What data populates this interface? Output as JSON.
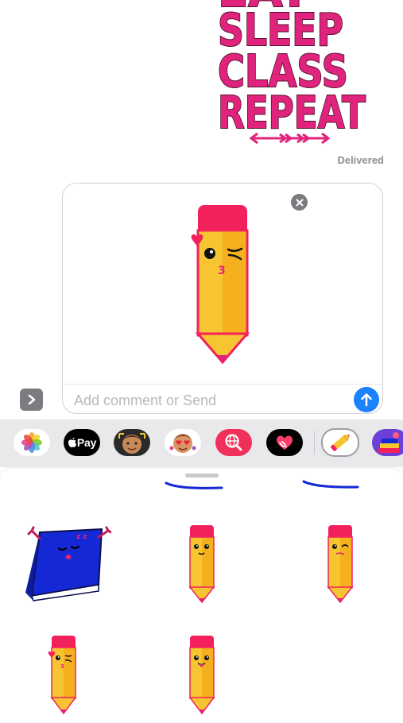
{
  "conversation": {
    "sent_sticker": {
      "lines": [
        "EAT",
        "SLEEP",
        "CLASS",
        "REPEAT"
      ],
      "color": "#e0247d"
    },
    "status": "Delivered"
  },
  "compose": {
    "placeholder": "Add comment or Send",
    "value": "",
    "preview_sticker": "pencil-winking-kiss-sticker"
  },
  "app_strip": {
    "apps": [
      {
        "name": "photos-app-icon"
      },
      {
        "name": "apple-pay-app-icon",
        "label": "Pay"
      },
      {
        "name": "memoji-app-icon"
      },
      {
        "name": "memoji-stickers-app-icon"
      },
      {
        "name": "images-search-app-icon"
      },
      {
        "name": "digital-touch-app-icon"
      },
      {
        "name": "pencil-stickers-app-icon",
        "selected": true
      },
      {
        "name": "school-stickers-app-icon"
      }
    ]
  },
  "sticker_drawer": {
    "stickers": [
      {
        "name": "sleeping-book-sticker",
        "mood": "sleepy",
        "zz": "z z"
      },
      {
        "name": "pencil-smiling-sticker",
        "mood": "smile"
      },
      {
        "name": "pencil-winking-sticker",
        "mood": "wink"
      },
      {
        "name": "pencil-kiss-heart-sticker",
        "mood": "kiss",
        "kiss_mark": "3"
      },
      {
        "name": "pencil-tongue-sticker",
        "mood": "tongue"
      }
    ]
  },
  "colors": {
    "accent_blue": "#1a82fb",
    "pencil_body": "#f7c531",
    "pencil_band": "#f2215c",
    "sticker_magenta": "#e0247d",
    "book_blue": "#1428d6"
  }
}
